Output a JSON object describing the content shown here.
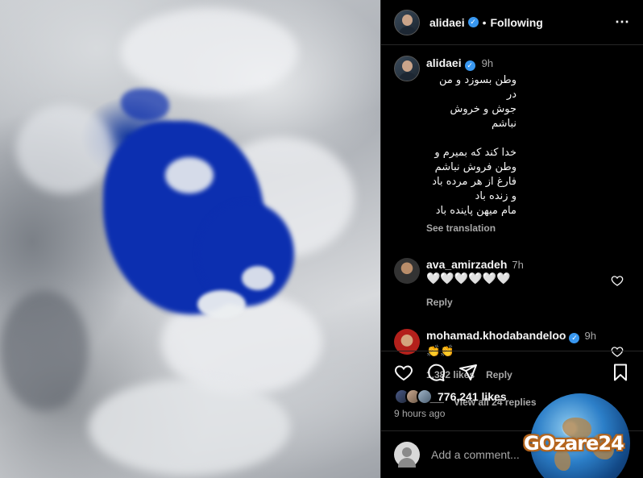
{
  "header": {
    "username": "alidaei",
    "separator": "•",
    "follow_status": "Following",
    "more_icon": "more-horizontal-icon"
  },
  "caption": {
    "username": "alidaei",
    "time": "9h",
    "text": "وطن بسوزد و من در\nجوش و خروش نباشم\n\nخدا کند که بمیرم و\nوطن فروش نباشم\nفارغ از هر مرده باد و زنده باد\nمام میهن پاینده باد",
    "see_translation": "See translation"
  },
  "comments": [
    {
      "username": "ava_amirzadeh",
      "time": "7h",
      "text": "🤍🤍🤍🤍🤍🤍",
      "reply": "Reply"
    },
    {
      "username": "mohamad.khodabandeloo",
      "verified": true,
      "time": "9h",
      "text": "👏👏",
      "likes": "1,382 likes",
      "reply": "Reply",
      "view_replies": "View all 24 replies"
    }
  ],
  "actions": {
    "like_icon": "heart-icon",
    "comment_icon": "comment-icon",
    "share_icon": "share-icon",
    "save_icon": "bookmark-icon"
  },
  "likes": {
    "count": "776,241 likes"
  },
  "posted_ago": "9 hours ago",
  "add_comment": {
    "placeholder": "Add a comment..."
  },
  "watermark": {
    "text": "GOzare24"
  },
  "colors": {
    "background": "#000000",
    "verified": "#3897f0",
    "muted": "#a8a8a8",
    "divider": "#262626"
  }
}
